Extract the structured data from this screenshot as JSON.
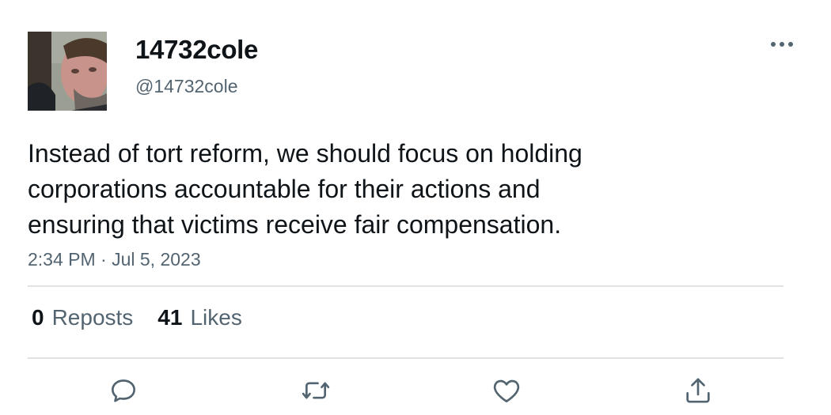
{
  "tweet": {
    "display_name": "14732cole",
    "handle": "@14732cole",
    "text": "Instead of tort reform, we should focus on holding\ncorporations accountable for their actions and\nensuring that victims receive fair compensation.",
    "timestamp": "2:34 PM · Jul 5, 2023"
  },
  "stats": {
    "reposts": {
      "count": "0",
      "label": "Reposts"
    },
    "likes": {
      "count": "41",
      "label": "Likes"
    }
  },
  "icons": {
    "more": "more-horizontal-icon",
    "reply": "comment-bubble-icon",
    "repost": "repost-arrows-icon",
    "like": "heart-icon",
    "share": "share-upload-icon"
  },
  "colors": {
    "text_primary": "#0f1419",
    "text_secondary": "#536471",
    "divider": "#dfe3e6"
  }
}
